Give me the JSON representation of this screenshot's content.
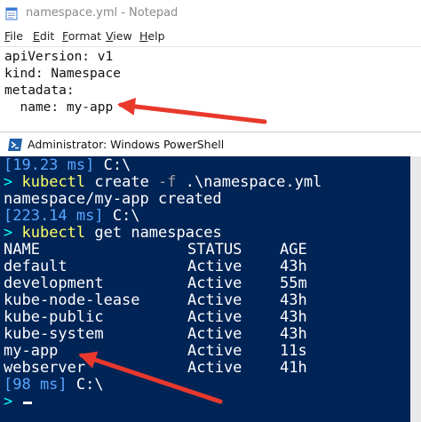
{
  "notepad": {
    "title": "namespace.yml - Notepad",
    "icon": "notepad-icon",
    "menu": [
      {
        "mnemonic": "F",
        "rest": "ile"
      },
      {
        "mnemonic": "E",
        "rest": "dit"
      },
      {
        "mnemonic": "F",
        "rest": "ormat"
      },
      {
        "mnemonic": "V",
        "rest": "iew"
      },
      {
        "mnemonic": "H",
        "rest": "elp"
      }
    ],
    "lines": [
      "apiVersion: v1",
      "kind: Namespace",
      "metadata:",
      "  name: my-app"
    ]
  },
  "powershell": {
    "title": "Administrator: Windows PowerShell",
    "icon": "powershell-icon",
    "colors": {
      "background": "#012456",
      "text": "#ffffff",
      "command": "#ffff66",
      "prompt_arrow": "#00ffff"
    },
    "prompt1": {
      "timing": "[19.23 ms]",
      "path": " C:\\"
    },
    "command1": {
      "arrow": ">",
      "cmd": "kubectl",
      "args_a": " create ",
      "flag": "-f",
      "args_b": " .\\namespace.yml"
    },
    "output1": "namespace/my-app created",
    "prompt2": {
      "timing": "[223.14 ms]",
      "path": " C:\\"
    },
    "command2": {
      "arrow": ">",
      "cmd": "kubectl",
      "args": " get namespaces"
    },
    "table": {
      "headers": {
        "name": "NAME",
        "status": "STATUS",
        "age": "AGE"
      },
      "rows": [
        {
          "name": "default",
          "status": "Active",
          "age": "43h"
        },
        {
          "name": "development",
          "status": "Active",
          "age": "55m"
        },
        {
          "name": "kube-node-lease",
          "status": "Active",
          "age": "43h"
        },
        {
          "name": "kube-public",
          "status": "Active",
          "age": "43h"
        },
        {
          "name": "kube-system",
          "status": "Active",
          "age": "43h"
        },
        {
          "name": "my-app",
          "status": "Active",
          "age": "11s"
        },
        {
          "name": "webserver",
          "status": "Active",
          "age": "41h"
        }
      ]
    },
    "prompt3": {
      "timing": "[98 ms]",
      "path": " C:\\"
    },
    "prompt4": {
      "arrow": ">"
    }
  },
  "annotations": {
    "arrow_color": "#e8392c"
  }
}
